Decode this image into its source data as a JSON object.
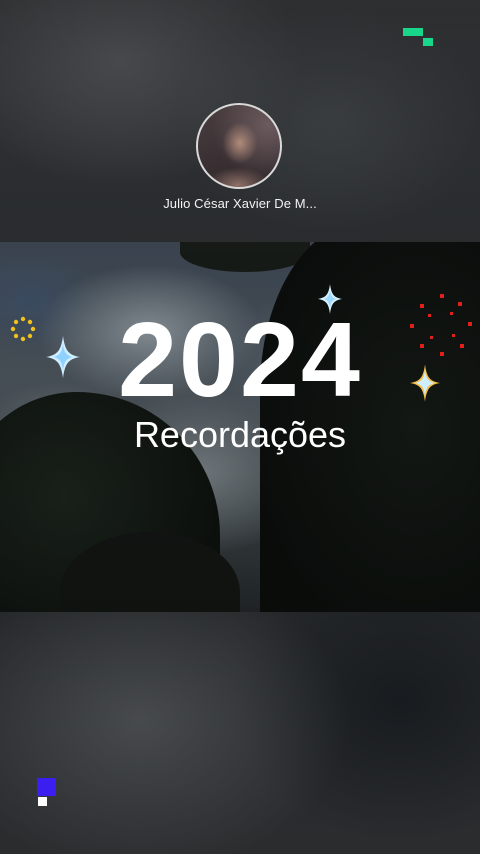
{
  "profile": {
    "name": "Julio César Xavier De M..."
  },
  "video": {
    "title": "2024",
    "subtitle": "Recordações"
  },
  "colors": {
    "brand_top": "#18d68a",
    "brand_bottom_primary": "#3a1ff0",
    "sparkle": "#9fd9ff",
    "sparkle_accent": "#f4c04a",
    "firework_red": "#e0201a",
    "firework_yellow": "#f2c21a"
  },
  "icons": {
    "top_right": "brand-pixel-logo-icon",
    "bottom_left": "brand-pixel-logo-icon"
  }
}
